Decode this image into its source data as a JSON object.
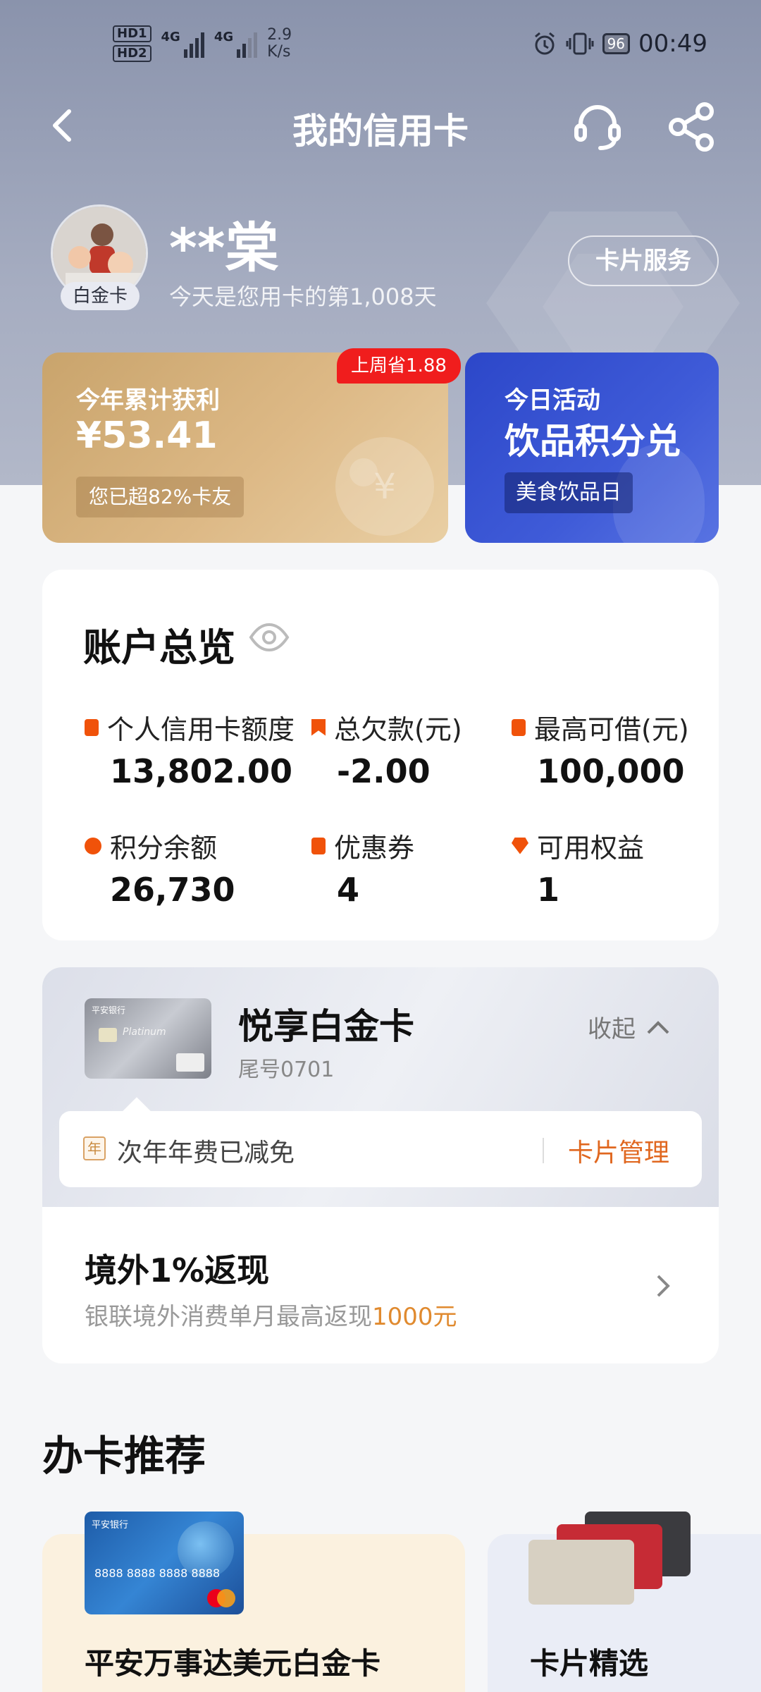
{
  "status_bar": {
    "hd1": "HD1",
    "hd2": "HD2",
    "signal1": "4G",
    "signal2": "4G",
    "speed_value": "2.9",
    "speed_unit": "K/s",
    "battery": "96",
    "time": "00:49"
  },
  "header": {
    "title": "我的信用卡",
    "back_icon": "chevron-left-icon",
    "support_icon": "headset-icon",
    "share_icon": "share-icon"
  },
  "profile": {
    "name": "**棠",
    "tier": "白金卡",
    "days_text": "今天是您用卡的第1,008天",
    "card_service_label": "卡片服务"
  },
  "gain_card": {
    "title": "今年累计获利",
    "amount": "¥53.41",
    "rank": "您已超82%卡友",
    "saved_tag": "上周省1.88",
    "coin_symbol": "¥"
  },
  "activity_card": {
    "label": "今日活动",
    "title": "饮品积分兑",
    "tag": "美食饮品日"
  },
  "overview": {
    "title": "账户总览",
    "stats": [
      {
        "label": "个人信用卡额度",
        "value": "13,802.00"
      },
      {
        "label": "总欠款(元)",
        "value": "-2.00"
      },
      {
        "label": "最高可借(元)",
        "value": "100,000"
      },
      {
        "label": "积分余额",
        "value": "26,730"
      },
      {
        "label": "优惠券",
        "value": "4"
      },
      {
        "label": "可用权益",
        "value": "1"
      }
    ]
  },
  "card": {
    "name": "悦享白金卡",
    "tail": "尾号0701",
    "collapse_label": "收起",
    "fee_icon_text": "年",
    "fee_text": "次年年费已减免",
    "manage_label": "卡片管理",
    "thumb_bank": "平安银行",
    "thumb_platinum": "Platinum"
  },
  "promo": {
    "title": "境外1%返现",
    "desc_prefix": "银联境外消费单月最高返现",
    "desc_highlight": "1000元"
  },
  "recommend": {
    "title": "办卡推荐",
    "items": [
      {
        "name": "平安万事达美元白金卡",
        "thumb_bank": "平安银行",
        "thumb_number": "8888 8888 8888 8888"
      },
      {
        "name": "卡片精选"
      }
    ]
  },
  "colors": {
    "accent_orange": "#e0671f",
    "red_tag": "#f01d1d",
    "gold_card": "#d9b47e",
    "blue_card": "#3a55d4"
  }
}
